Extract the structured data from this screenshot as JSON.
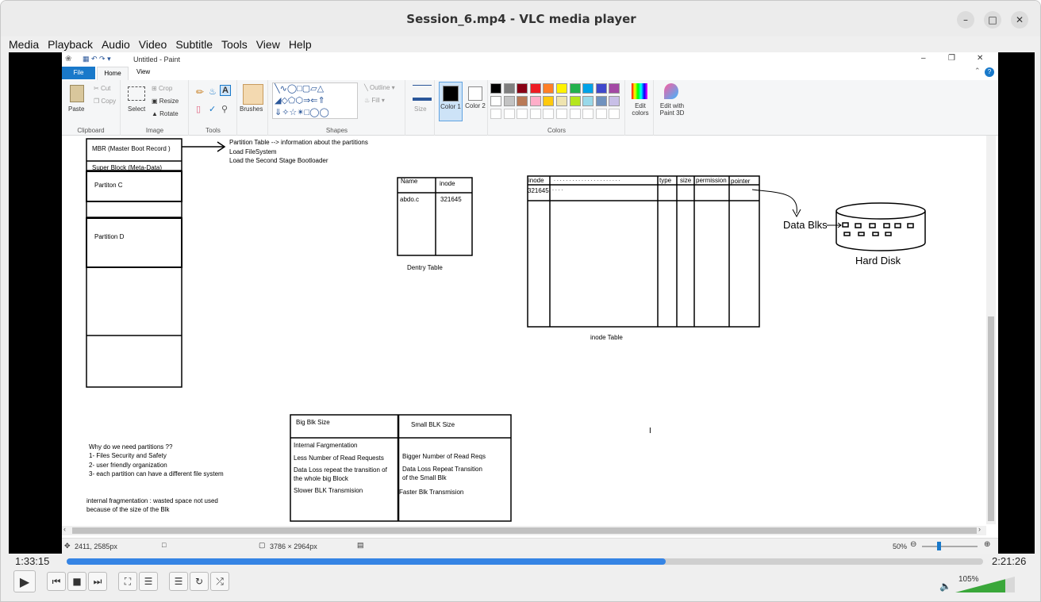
{
  "window": {
    "title": "Session_6.mp4 - VLC media player"
  },
  "menu": [
    "Media",
    "Playback",
    "Audio",
    "Video",
    "Subtitle",
    "Tools",
    "View",
    "Help"
  ],
  "paint": {
    "title": "Untitled - Paint",
    "tabs": [
      "File",
      "Home",
      "View"
    ],
    "clipboard": {
      "paste": "Paste",
      "cut": "Cut",
      "copy": "Copy",
      "label": "Clipboard"
    },
    "image": {
      "select": "Select",
      "crop": "Crop",
      "resize": "Resize",
      "rotate": "Rotate",
      "label": "Image"
    },
    "tools": {
      "label": "Tools"
    },
    "brushes": "Brushes",
    "shapes": {
      "outline": "Outline",
      "fill": "Fill",
      "label": "Shapes"
    },
    "size": "Size",
    "color1": "Color 1",
    "color2": "Color 2",
    "colors_label": "Colors",
    "edit_colors": "Edit colors",
    "paint3d": "Edit with Paint 3D",
    "palette": [
      "#000000",
      "#7f7f7f",
      "#880015",
      "#ed1c24",
      "#ff7f27",
      "#fff200",
      "#22b14c",
      "#00a2e8",
      "#3f48cc",
      "#a349a4",
      "#ffffff",
      "#c3c3c3",
      "#b97a57",
      "#ffaec9",
      "#ffc90e",
      "#efe4b0",
      "#b5e61d",
      "#99d9ea",
      "#7092be",
      "#c8bfe7"
    ],
    "status": {
      "cursor": "2411, 2585px",
      "dims": "3786 × 2964px",
      "zoom": "50%"
    }
  },
  "drawing": {
    "mbr": "MBR (Master Boot Record )",
    "super": "Super Block  (Meta-Data)",
    "partc": "Partiton C",
    "partd": "Partition D",
    "notes": [
      "Partition Table --> information about the partitions",
      "Load FileSystem",
      "Load the Second Stage Bootloader"
    ],
    "dentry": {
      "h1": "Name",
      "h2": "inode",
      "c1": "abdo.c",
      "c2": "321645",
      "caption": "Dentry Table"
    },
    "inode": {
      "h": [
        "inode",
        ". . . . . . . . . . . . . . . . . . . . . .",
        "type",
        "size",
        "permission",
        "pointer"
      ],
      "r1": "321645",
      "r1b": ". . . .",
      "caption": "inode Table"
    },
    "datablks": "Data Blks",
    "harddisk": "Hard Disk",
    "why": [
      "Why do we need partitions ??",
      "1- Files Security and Safety",
      "2- user friendly organization",
      "3- each partition can have a different file system"
    ],
    "frag": [
      "internal fragmentation : wasted space not used",
      "because of the size of the Blk"
    ],
    "blk": {
      "big": "Big Blk Size",
      "small": "Small BLK Size",
      "bigitems": [
        "Internal Fargmentation",
        "Less Number of Read Requests",
        "Data Loss repeat the transition of",
        "the whole big Block",
        "Slower BLK  Transmision"
      ],
      "smallitems": [
        "Bigger Number of Read Reqs",
        "Data Loss Repeat Transition",
        "of the Small Blk",
        "Faster Blk Transmision"
      ]
    }
  },
  "player": {
    "elapsed": "1:33:15",
    "total": "2:21:26",
    "progress": 0.654,
    "volume": "105%",
    "volume_level": 1.05
  }
}
